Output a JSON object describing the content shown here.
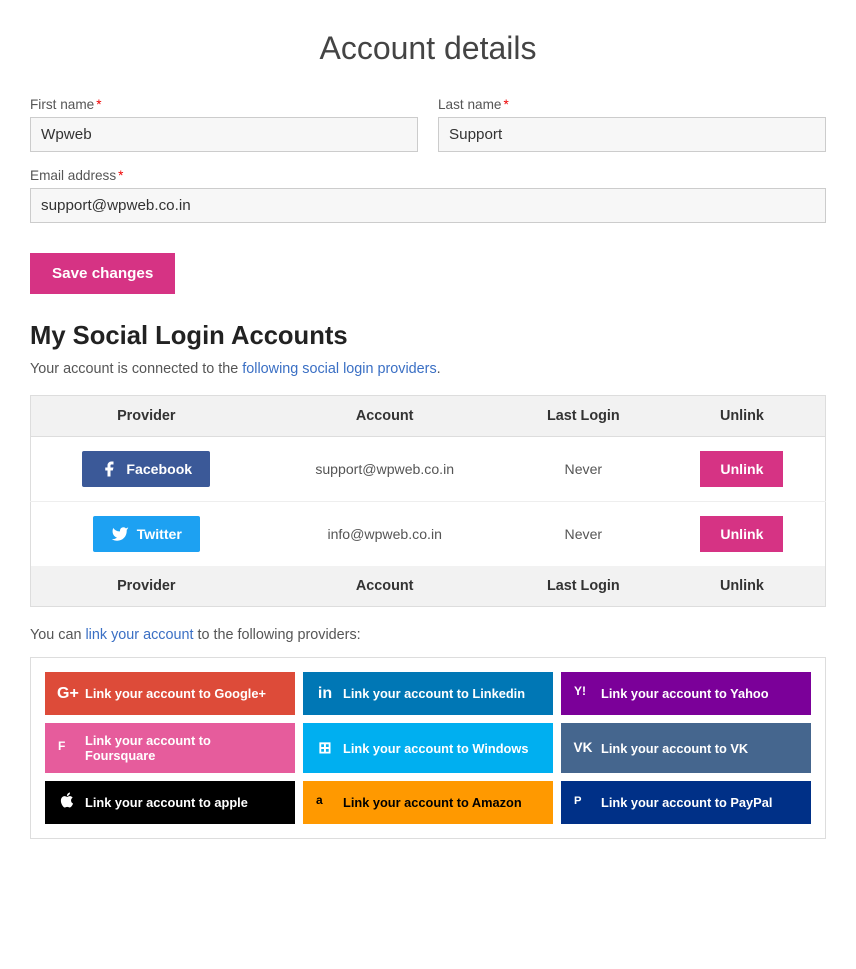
{
  "page": {
    "title": "Account details"
  },
  "form": {
    "first_name_label": "First name",
    "last_name_label": "Last name",
    "email_label": "Email address",
    "first_name_value": "Wpweb",
    "last_name_value": "Support",
    "email_value": "support@wpweb.co.in",
    "save_button": "Save changes"
  },
  "social": {
    "section_title": "My Social Login Accounts",
    "connected_text_pre": "Your account is connected to the ",
    "connected_text_link": "following social login providers",
    "connected_text_post": ".",
    "table_headers": [
      "Provider",
      "Account",
      "Last Login",
      "Unlink"
    ],
    "connected_accounts": [
      {
        "provider": "Facebook",
        "account": "support@wpweb.co.in",
        "last_login": "Never",
        "unlink_label": "Unlink",
        "style": "facebook"
      },
      {
        "provider": "Twitter",
        "account": "info@wpweb.co.in",
        "last_login": "Never",
        "unlink_label": "Unlink",
        "style": "twitter"
      }
    ],
    "can_link_pre": "You can ",
    "can_link_link": "link your account",
    "can_link_post": " to the following providers:",
    "link_providers": [
      {
        "label": "Link your account to Google+",
        "style": "google",
        "icon": "G+"
      },
      {
        "label": "Link your account to Linkedin",
        "style": "linkedin",
        "icon": "in"
      },
      {
        "label": "Link your account to Yahoo",
        "style": "yahoo",
        "icon": "Y!"
      },
      {
        "label": "Link your account to Foursquare",
        "style": "foursquare",
        "icon": "F"
      },
      {
        "label": "Link your account to Windows",
        "style": "windows",
        "icon": "⊞"
      },
      {
        "label": "Link your account to VK",
        "style": "vk",
        "icon": "VK"
      },
      {
        "label": "Link your account to apple",
        "style": "apple",
        "icon": ""
      },
      {
        "label": "Link your account to Amazon",
        "style": "amazon",
        "icon": "a"
      },
      {
        "label": "Link your account to PayPal",
        "style": "paypal",
        "icon": "P"
      }
    ]
  }
}
